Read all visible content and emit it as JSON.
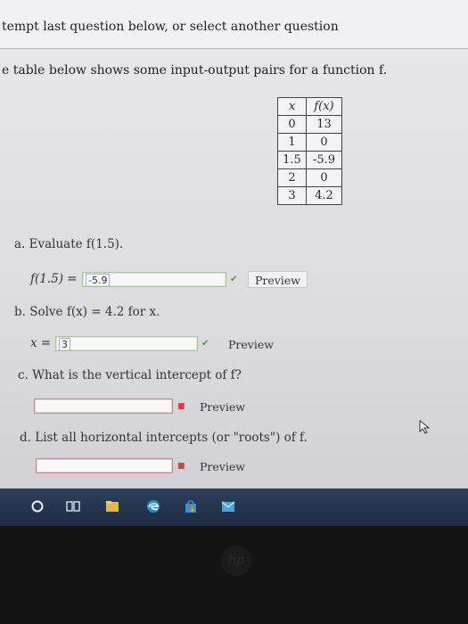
{
  "header": {
    "instruction": "tempt last question below, or select another question"
  },
  "problem": {
    "intro": "e table below shows some input-output pairs for a function f."
  },
  "table": {
    "headers": [
      "x",
      "f(x)"
    ],
    "rows": [
      [
        "0",
        "13"
      ],
      [
        "1",
        "0"
      ],
      [
        "1.5",
        "-5.9"
      ],
      [
        "2",
        "0"
      ],
      [
        "3",
        "4.2"
      ]
    ]
  },
  "parts": {
    "a": {
      "question": "a. Evaluate f(1.5).",
      "lhs": "f(1.5) =",
      "answer": "-5.9",
      "preview": "Preview"
    },
    "b": {
      "question": "b. Solve f(x) = 4.2 for x.",
      "lhs": "x =",
      "answer": "3",
      "preview": "Preview"
    },
    "c": {
      "question": "c. What is the vertical intercept of f?",
      "answer": "",
      "preview": "Preview"
    },
    "d": {
      "question": "d. List all horizontal intercepts (or \"roots\") of f.",
      "answer": "",
      "preview": "Preview"
    }
  },
  "marks": {
    "correct": "✔",
    "incorrect": "■"
  },
  "icons": {
    "taskbar": [
      "start-circle-icon",
      "task-view-icon",
      "file-explorer-icon",
      "edge-browser-icon",
      "store-icon",
      "mail-icon"
    ]
  },
  "colors": {
    "correct_border": "#a9c98a",
    "incorrect_border": "#c08a8a",
    "taskbar": "#24344e"
  }
}
